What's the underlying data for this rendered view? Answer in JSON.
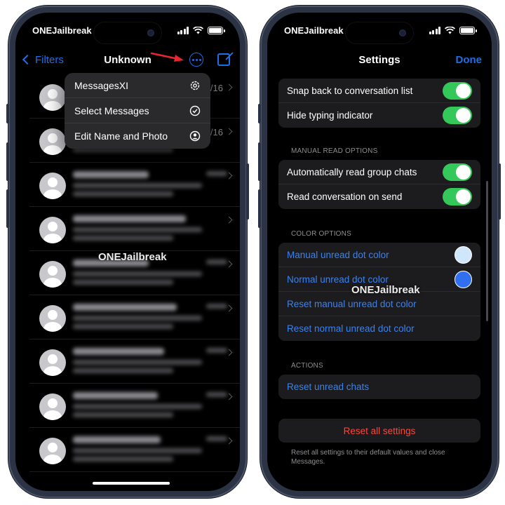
{
  "left_phone": {
    "status": {
      "carrier": "ONEJailbreak"
    },
    "nav": {
      "back_label": "Filters",
      "title": "Unknown"
    },
    "menu": [
      {
        "label": "MessagesXI",
        "icon": "gear-icon"
      },
      {
        "label": "Select Messages",
        "icon": "checkmark-circle-icon"
      },
      {
        "label": "Edit Name and Photo",
        "icon": "person-circle-icon"
      }
    ],
    "conversations": [
      {
        "date": "/16"
      },
      {
        "date": "/16"
      },
      {
        "date": ""
      },
      {
        "date": ""
      },
      {
        "date": ""
      },
      {
        "date": ""
      },
      {
        "date": ""
      },
      {
        "date": ""
      },
      {
        "date": ""
      }
    ],
    "watermark": "ONEJailbreak"
  },
  "right_phone": {
    "status": {
      "carrier": "ONEJailbreak"
    },
    "nav": {
      "title": "Settings",
      "done_label": "Done"
    },
    "sections": {
      "conversation": {
        "rows": [
          {
            "label": "Snap back to conversation list",
            "on": true
          },
          {
            "label": "Hide typing indicator",
            "on": true
          }
        ]
      },
      "manual_read": {
        "header": "MANUAL READ OPTIONS",
        "rows": [
          {
            "label": "Automatically read group chats",
            "on": true
          },
          {
            "label": "Read conversation on send",
            "on": true
          }
        ]
      },
      "color": {
        "header": "COLOR OPTIONS",
        "rows": [
          {
            "label": "Manual unread dot color",
            "color": "#cfe6fb"
          },
          {
            "label": "Normal unread dot color",
            "color": "#2f6ff0"
          },
          {
            "label": "Reset manual unread dot color"
          },
          {
            "label": "Reset normal unread dot color"
          }
        ]
      },
      "actions": {
        "header": "ACTIONS",
        "rows": [
          {
            "label": "Reset unread chats"
          }
        ]
      }
    },
    "reset_all": "Reset all settings",
    "footer": "Reset all settings to their default values and close Messages.",
    "watermark": "ONEJailbreak"
  },
  "colors": {
    "accent": "#1e6fe8",
    "toggle_on": "#34c759",
    "destructive": "#ff453a",
    "frame": "#2b3344"
  }
}
